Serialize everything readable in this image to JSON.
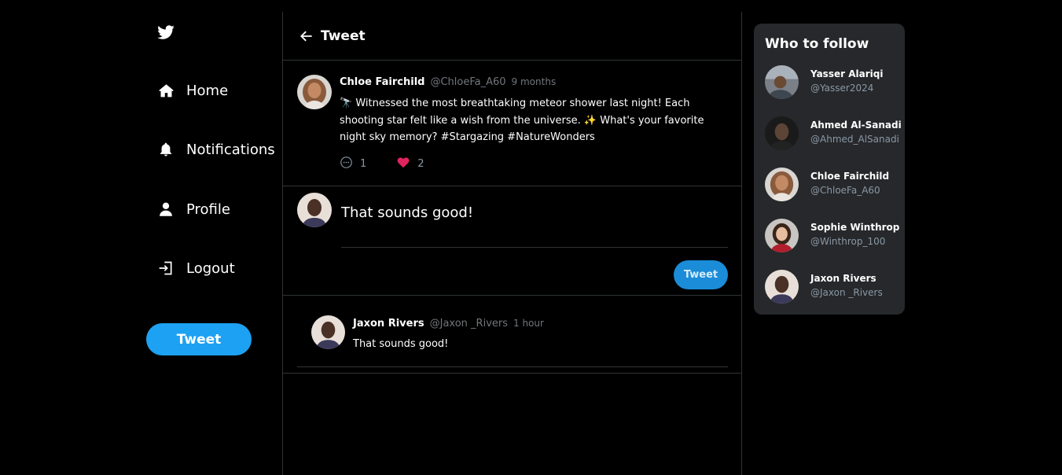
{
  "sidebar": {
    "logo": "twitter-bird-icon",
    "items": [
      {
        "label": "Home",
        "icon": "home-icon"
      },
      {
        "label": "Notifications",
        "icon": "bell-icon"
      },
      {
        "label": "Profile",
        "icon": "user-icon"
      },
      {
        "label": "Logout",
        "icon": "logout-icon"
      }
    ],
    "tweet_button": "Tweet"
  },
  "header": {
    "title": "Tweet",
    "back_icon": "arrow-left-icon"
  },
  "tweet": {
    "name": "Chloe Fairchild",
    "handle": "@ChloeFa_A60",
    "time": "9 months",
    "text": "🔭 Witnessed the most breathtaking meteor shower last night! Each shooting star felt like a wish from the universe. ✨ What's your favorite night sky memory? #Stargazing #NatureWonders",
    "replies": "1",
    "likes": "2",
    "liked": true
  },
  "composer": {
    "value": "That sounds good!",
    "button": "Tweet"
  },
  "reply": {
    "name": "Jaxon Rivers",
    "handle": "@Jaxon _Rivers",
    "time": "1 hour",
    "text": "That sounds good!"
  },
  "who_to_follow": {
    "title": "Who to follow",
    "users": [
      {
        "name": "Yasser Alariqi",
        "handle": "@Yasser2024"
      },
      {
        "name": "Ahmed Al-Sanadi",
        "handle": "@Ahmed_AlSanadi"
      },
      {
        "name": "Chloe Fairchild",
        "handle": "@ChloeFa_A60"
      },
      {
        "name": "Sophie Winthrop",
        "handle": "@Winthrop_100"
      },
      {
        "name": "Jaxon Rivers",
        "handle": "@Jaxon _Rivers"
      }
    ]
  },
  "colors": {
    "accent": "#1da1f2",
    "like": "#f91880",
    "border": "#2f3336",
    "card": "#26282b"
  }
}
